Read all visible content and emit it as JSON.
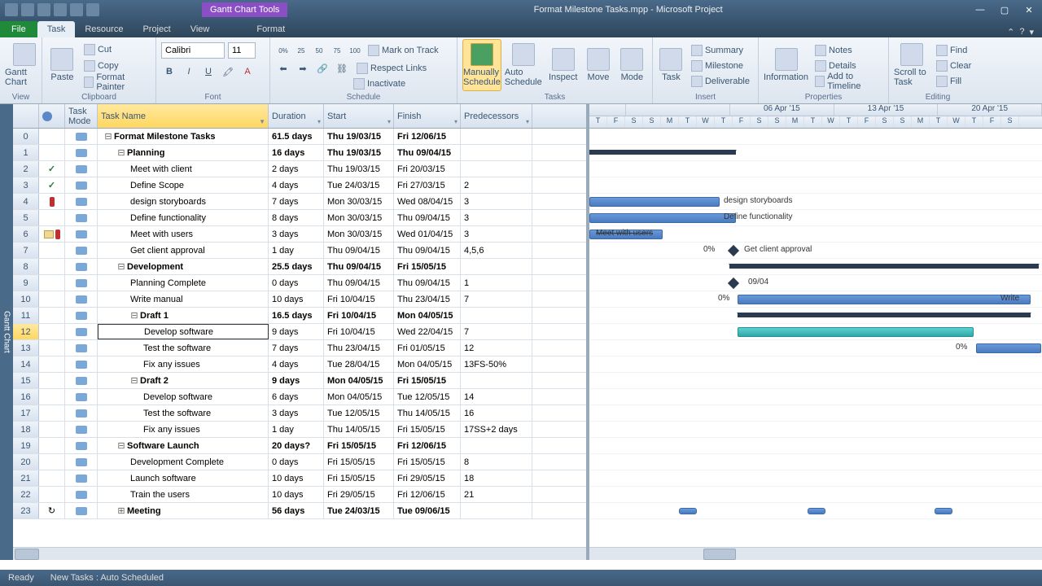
{
  "app": {
    "title": "Format Milestone Tasks.mpp - Microsoft Project",
    "tool_tab": "Gantt Chart Tools"
  },
  "ribbon_tabs": {
    "file": "File",
    "task": "Task",
    "resource": "Resource",
    "project": "Project",
    "view": "View",
    "format": "Format"
  },
  "groups": {
    "view": "View",
    "clipboard": "Clipboard",
    "font": "Font",
    "schedule": "Schedule",
    "tasks": "Tasks",
    "insert": "Insert",
    "properties": "Properties",
    "editing": "Editing"
  },
  "clipboard": {
    "paste": "Paste",
    "cut": "Cut",
    "copy": "Copy",
    "fp": "Format Painter"
  },
  "font": {
    "name": "Calibri",
    "size": "11"
  },
  "schedule": {
    "mark": "Mark on Track",
    "respect": "Respect Links",
    "inactivate": "Inactivate",
    "manual": "Manually Schedule",
    "auto": "Auto Schedule"
  },
  "tasks_g": {
    "inspect": "Inspect",
    "move": "Move",
    "mode": "Mode"
  },
  "insert": {
    "task": "Task",
    "summary": "Summary",
    "milestone": "Milestone",
    "deliverable": "Deliverable"
  },
  "props": {
    "info": "Information",
    "notes": "Notes",
    "details": "Details",
    "timeline": "Add to Timeline"
  },
  "editing": {
    "scroll": "Scroll to Task",
    "find": "Find",
    "clear": "Clear",
    "fill": "Fill"
  },
  "gantt_btn": "Gantt Chart",
  "columns": {
    "mode": "Task Mode",
    "name": "Task Name",
    "dur": "Duration",
    "start": "Start",
    "fin": "Finish",
    "pred": "Predecessors"
  },
  "timeline_weeks": [
    "06 Apr '15",
    "13 Apr '15",
    "20 Apr '15"
  ],
  "timeline_days": [
    "T",
    "F",
    "S",
    "S",
    "M",
    "T",
    "W",
    "T",
    "F",
    "S",
    "S",
    "M",
    "T",
    "W",
    "T",
    "F",
    "S",
    "S",
    "M",
    "T",
    "W",
    "T",
    "F",
    "S"
  ],
  "tasks": [
    {
      "n": 0,
      "name": "Format Milestone Tasks",
      "dur": "61.5 days",
      "start": "Thu 19/03/15",
      "fin": "Fri 12/06/15",
      "pred": "",
      "lvl": 0,
      "bold": true,
      "out": "-"
    },
    {
      "n": 1,
      "name": "Planning",
      "dur": "16 days",
      "start": "Thu 19/03/15",
      "fin": "Thu 09/04/15",
      "pred": "",
      "lvl": 1,
      "bold": true,
      "out": "-"
    },
    {
      "n": 2,
      "name": "Meet with client",
      "dur": "2 days",
      "start": "Thu 19/03/15",
      "fin": "Fri 20/03/15",
      "pred": "",
      "lvl": 2,
      "ind": "check"
    },
    {
      "n": 3,
      "name": "Define Scope",
      "dur": "4 days",
      "start": "Tue 24/03/15",
      "fin": "Fri 27/03/15",
      "pred": "2",
      "lvl": 2,
      "ind": "check"
    },
    {
      "n": 4,
      "name": "design storyboards",
      "dur": "7 days",
      "start": "Mon 30/03/15",
      "fin": "Wed 08/04/15",
      "pred": "3",
      "lvl": 2,
      "ind": "red"
    },
    {
      "n": 5,
      "name": "Define functionality",
      "dur": "8 days",
      "start": "Mon 30/03/15",
      "fin": "Thu 09/04/15",
      "pred": "3",
      "lvl": 2
    },
    {
      "n": 6,
      "name": "Meet with users",
      "dur": "3 days",
      "start": "Mon 30/03/15",
      "fin": "Wed 01/04/15",
      "pred": "3",
      "lvl": 2,
      "ind": "notered"
    },
    {
      "n": 7,
      "name": "Get client approval",
      "dur": "1 day",
      "start": "Thu 09/04/15",
      "fin": "Thu 09/04/15",
      "pred": "4,5,6",
      "lvl": 2
    },
    {
      "n": 8,
      "name": "Development",
      "dur": "25.5 days",
      "start": "Thu 09/04/15",
      "fin": "Fri 15/05/15",
      "pred": "",
      "lvl": 1,
      "bold": true,
      "out": "-"
    },
    {
      "n": 9,
      "name": "Planning Complete",
      "dur": "0 days",
      "start": "Thu 09/04/15",
      "fin": "Thu 09/04/15",
      "pred": "1",
      "lvl": 2
    },
    {
      "n": 10,
      "name": "Write manual",
      "dur": "10 days",
      "start": "Fri 10/04/15",
      "fin": "Thu 23/04/15",
      "pred": "7",
      "lvl": 2
    },
    {
      "n": 11,
      "name": "Draft 1",
      "dur": "16.5 days",
      "start": "Fri 10/04/15",
      "fin": "Mon 04/05/15",
      "pred": "",
      "lvl": 2,
      "bold": true,
      "out": "-"
    },
    {
      "n": 12,
      "name": "Develop software",
      "dur": "9 days",
      "start": "Fri 10/04/15",
      "fin": "Wed 22/04/15",
      "pred": "7",
      "lvl": 3,
      "sel": true
    },
    {
      "n": 13,
      "name": "Test the software",
      "dur": "7 days",
      "start": "Thu 23/04/15",
      "fin": "Fri 01/05/15",
      "pred": "12",
      "lvl": 3
    },
    {
      "n": 14,
      "name": "Fix any issues",
      "dur": "4 days",
      "start": "Tue 28/04/15",
      "fin": "Mon 04/05/15",
      "pred": "13FS-50%",
      "lvl": 3
    },
    {
      "n": 15,
      "name": "Draft 2",
      "dur": "9 days",
      "start": "Mon 04/05/15",
      "fin": "Fri 15/05/15",
      "pred": "",
      "lvl": 2,
      "bold": true,
      "out": "-"
    },
    {
      "n": 16,
      "name": "Develop software",
      "dur": "6 days",
      "start": "Mon 04/05/15",
      "fin": "Tue 12/05/15",
      "pred": "14",
      "lvl": 3
    },
    {
      "n": 17,
      "name": "Test the software",
      "dur": "3 days",
      "start": "Tue 12/05/15",
      "fin": "Thu 14/05/15",
      "pred": "16",
      "lvl": 3
    },
    {
      "n": 18,
      "name": "Fix any issues",
      "dur": "1 day",
      "start": "Thu 14/05/15",
      "fin": "Fri 15/05/15",
      "pred": "17SS+2 days",
      "lvl": 3
    },
    {
      "n": 19,
      "name": "Software Launch",
      "dur": "20 days?",
      "start": "Fri 15/05/15",
      "fin": "Fri 12/06/15",
      "pred": "",
      "lvl": 1,
      "bold": true,
      "out": "-"
    },
    {
      "n": 20,
      "name": "Development Complete",
      "dur": "0 days",
      "start": "Fri 15/05/15",
      "fin": "Fri 15/05/15",
      "pred": "8",
      "lvl": 2
    },
    {
      "n": 21,
      "name": "Launch software",
      "dur": "10 days",
      "start": "Fri 15/05/15",
      "fin": "Fri 29/05/15",
      "pred": "18",
      "lvl": 2
    },
    {
      "n": 22,
      "name": "Train the users",
      "dur": "10 days",
      "start": "Fri 29/05/15",
      "fin": "Fri 12/06/15",
      "pred": "21",
      "lvl": 2
    },
    {
      "n": 23,
      "name": "Meeting",
      "dur": "56 days",
      "start": "Tue 24/03/15",
      "fin": "Tue 09/06/15",
      "pred": "",
      "lvl": 1,
      "bold": true,
      "out": "+",
      "ind": "recur"
    }
  ],
  "gantt_labels": {
    "r4": "design storyboards",
    "r5": "Define functionality",
    "r6": "Meet with users",
    "r7": "Get client approval",
    "r9": "09/04",
    "r10": "Write"
  },
  "gantt_pct": {
    "r7": "0%",
    "r10": "0%",
    "r13": "0%"
  },
  "status": {
    "ready": "Ready",
    "newtasks": "New Tasks : Auto Scheduled"
  }
}
